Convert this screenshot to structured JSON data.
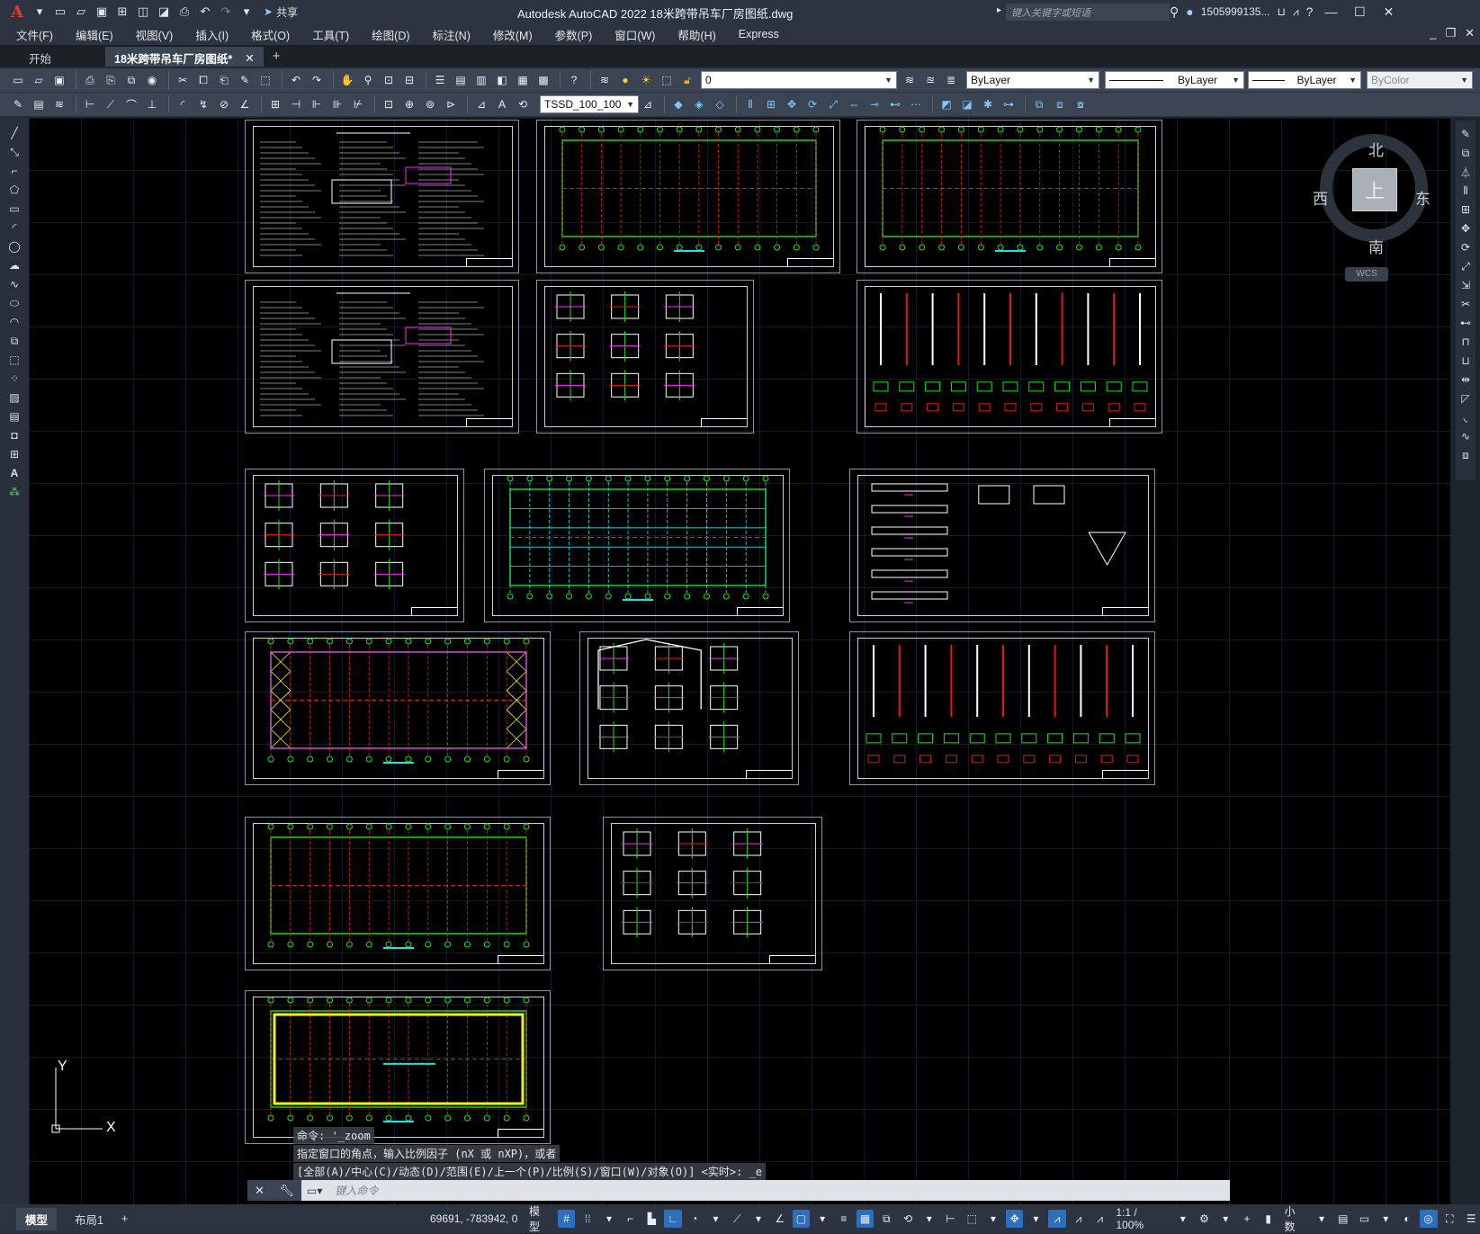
{
  "app": {
    "title": "Autodesk AutoCAD 2022    18米跨带吊车厂房图纸.dwg",
    "logo": "A",
    "share_label": "共享",
    "search_placeholder": "键入关键字或短语",
    "user": "1505999135...",
    "quick_access_icons": [
      "new-icon",
      "open-icon",
      "save-icon",
      "saveas-icon",
      "web-open-icon",
      "web-save-icon",
      "plot-icon",
      "undo-icon",
      "redo-icon",
      "dropdown-icon"
    ]
  },
  "menu": {
    "items": [
      "文件(F)",
      "编辑(E)",
      "视图(V)",
      "插入(I)",
      "格式(O)",
      "工具(T)",
      "绘图(D)",
      "标注(N)",
      "修改(M)",
      "参数(P)",
      "窗口(W)",
      "帮助(H)",
      "Express"
    ]
  },
  "tabs": {
    "items": [
      {
        "label": "开始",
        "active": false
      },
      {
        "label": "18米跨带吊车厂房图纸*",
        "active": true
      }
    ],
    "close": "✕",
    "add": "+"
  },
  "toolbar1": {
    "layer_value": "0",
    "color_value": "ByLayer",
    "linetype_value": "ByLayer",
    "lineweight_value": "ByLayer",
    "plotstyle_value": "ByColor"
  },
  "toolbar2": {
    "dimstyle_value": "TSSD_100_100"
  },
  "viewcube": {
    "top": "上",
    "north": "北",
    "south": "南",
    "east": "东",
    "west": "西",
    "wcs": "WCS"
  },
  "ucs": {
    "x": "X",
    "y": "Y"
  },
  "command": {
    "history": [
      "命令: '_zoom",
      "指定窗口的角点，输入比例因子 (nX 或 nXP)，或者",
      "[全部(A)/中心(C)/动态(D)/范围(E)/上一个(P)/比例(S)/窗口(W)/对象(O)] <实时>: _e"
    ],
    "placeholder": "键入命令"
  },
  "status": {
    "tabs": [
      {
        "label": "模型",
        "active": true
      },
      {
        "label": "布局1",
        "active": false
      }
    ],
    "add": "+",
    "coords": "69691, -783942, 0",
    "mode": "模型",
    "scale": "1:1 / 100%",
    "units": "小数"
  },
  "colors": {
    "background": "#000000",
    "chrome": "#2b3440",
    "toolbar": "#3b4452",
    "active_toggle": "#2d6fbd",
    "sheet_border": "#8a96a8",
    "green": "#19e619",
    "red": "#e61919",
    "magenta": "#ff26ff",
    "cyan": "#19e6e6",
    "yellow": "#f2f219",
    "white": "#ffffff"
  }
}
